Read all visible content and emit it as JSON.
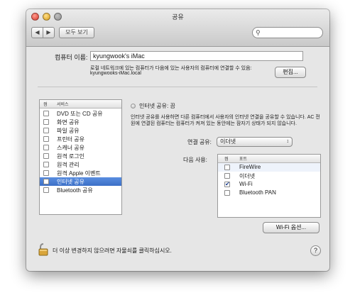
{
  "window": {
    "title": "공유"
  },
  "toolbar": {
    "back_icon": "◀",
    "forward_icon": "▶",
    "show_all_label": "모두 보기",
    "search_value": "",
    "search_icon": "🔍"
  },
  "computer": {
    "name_label": "컴퓨터 이름:",
    "name_value": "kyungwook's iMac",
    "info_line1": "로컬 네트워크에 있는 컴퓨터가 다음에 있는 사용자의 컴퓨터에 연결할 수 있음:",
    "info_line2": "kyungwooks-iMac.local",
    "edit_label": "편집..."
  },
  "services": {
    "header_on": "켬",
    "header_service": "서비스",
    "items": [
      {
        "label": "DVD 또는 CD 공유",
        "checked": false
      },
      {
        "label": "화면 공유",
        "checked": false
      },
      {
        "label": "파일 공유",
        "checked": false
      },
      {
        "label": "프린터 공유",
        "checked": false
      },
      {
        "label": "스캐너 공유",
        "checked": false
      },
      {
        "label": "원격 로그인",
        "checked": false
      },
      {
        "label": "원격 관리",
        "checked": false
      },
      {
        "label": "원격 Apple 이벤트",
        "checked": false
      },
      {
        "label": "인터넷 공유",
        "checked": false,
        "selected": true
      },
      {
        "label": "Bluetooth 공유",
        "checked": false
      }
    ]
  },
  "internet_sharing": {
    "status_title": "인터넷 공유: 끔",
    "description_line1": "인터넷 공유를 사용하면 다른 컴퓨터에서 사용자의 인터넷 연결을 공유할 수 있습니다. AC 전",
    "description_line2": "원에 연결된 컴퓨터는 컴퓨터가 켜져 있는 동안에는 잠자기 상태가 되지 않습니다.",
    "share_from_label": "연결 공유:",
    "share_from_value": "이더넷",
    "to_label": "다음 사용:",
    "ports_header_on": "켬",
    "ports_header_port": "포트",
    "ports": [
      {
        "label": "FireWire",
        "checked": false,
        "highlight": true
      },
      {
        "label": "이더넷",
        "checked": false
      },
      {
        "label": "Wi-Fi",
        "checked": true
      },
      {
        "label": "Bluetooth PAN",
        "checked": false
      }
    ],
    "wifi_options_label": "Wi-Fi 옵션..."
  },
  "footer": {
    "lock_text": "더 이상 변경하지 않으려면 자물쇠를 클릭하십시오.",
    "help_label": "?"
  }
}
